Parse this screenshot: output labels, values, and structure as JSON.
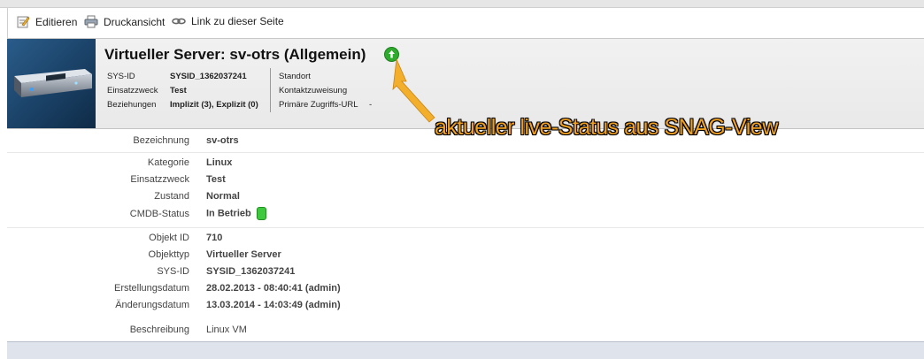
{
  "toolbar": {
    "edit_label": "Editieren",
    "print_label": "Druckansicht",
    "link_label": "Link zu dieser Seite"
  },
  "header": {
    "title": "Virtueller Server: sv-otrs (Allgemein)",
    "status_color": "#2eaa2e",
    "left_meta": [
      {
        "label": "SYS-ID",
        "value": "SYSID_1362037241"
      },
      {
        "label": "Einsatzzweck",
        "value": "Test"
      },
      {
        "label": "Beziehungen",
        "value": "Implizit (3), Explizit (0)"
      }
    ],
    "right_meta": [
      {
        "label": "Standort",
        "value": ""
      },
      {
        "label": "Kontaktzuweisung",
        "value": ""
      },
      {
        "label": "Primäre Zugriffs-URL",
        "value": "-"
      }
    ]
  },
  "annotation": "aktueller live-Status aus SNAG-View",
  "fields": {
    "bezeichnung": {
      "label": "Bezeichnung",
      "value": "sv-otrs"
    },
    "kategorie": {
      "label": "Kategorie",
      "value": "Linux"
    },
    "einsatzzweck": {
      "label": "Einsatzzweck",
      "value": "Test"
    },
    "zustand": {
      "label": "Zustand",
      "value": "Normal"
    },
    "cmdb_status": {
      "label": "CMDB-Status",
      "value": "In Betrieb",
      "color": "#3ec83e"
    },
    "objekt_id": {
      "label": "Objekt ID",
      "value": "710"
    },
    "objekttyp": {
      "label": "Objekttyp",
      "value": "Virtueller Server"
    },
    "sys_id": {
      "label": "SYS-ID",
      "value": "SYSID_1362037241"
    },
    "erstellungsdatum": {
      "label": "Erstellungsdatum",
      "value": "28.02.2013 - 08:40:41 (admin)"
    },
    "aenderungsdatum": {
      "label": "Änderungsdatum",
      "value": "13.03.2014 - 14:03:49 (admin)"
    },
    "beschreibung": {
      "label": "Beschreibung",
      "value": "Linux VM"
    }
  }
}
